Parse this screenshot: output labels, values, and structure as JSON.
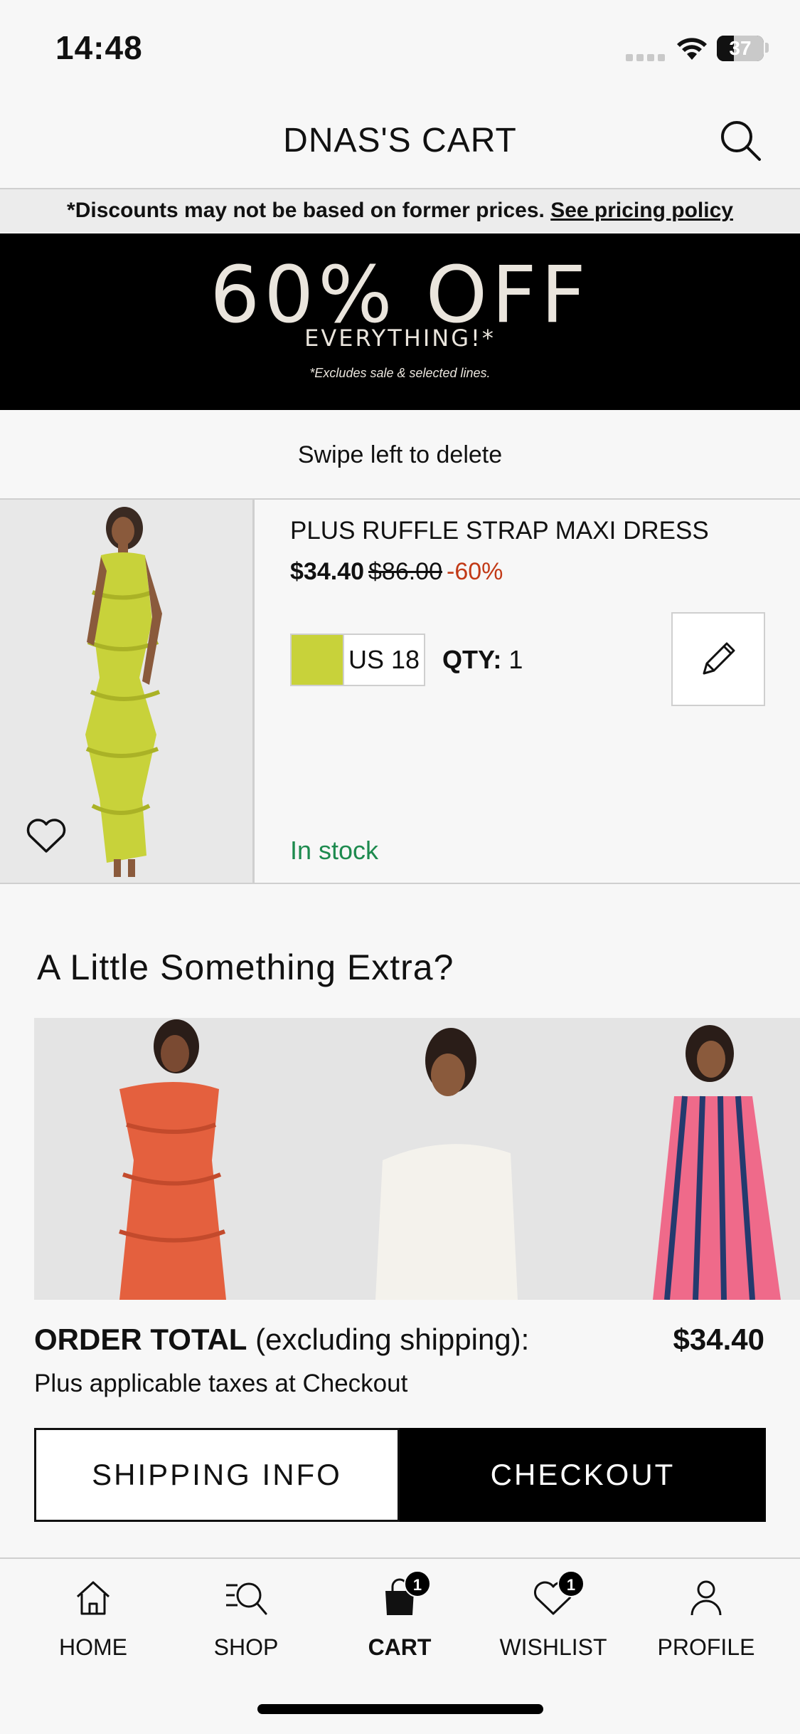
{
  "status_bar": {
    "time": "14:48",
    "battery": "37",
    "battery_level": 0.37
  },
  "header": {
    "title": "DNAS'S CART",
    "search_icon": "search-icon"
  },
  "disclaimer": {
    "text": "*Discounts may not be based on former prices. ",
    "link": "See pricing policy"
  },
  "promo": {
    "headline": "60% OFF",
    "subline": "EVERYTHING!*",
    "fineprint": "*Excludes sale & selected lines."
  },
  "swipe_hint": "Swipe left to delete",
  "cart_item": {
    "name": "PLUS RUFFLE STRAP MAXI DRESS",
    "price": "$34.40",
    "original_price": "$86.00",
    "discount": "-60%",
    "color_hex": "#c8d23a",
    "size": "US 18",
    "qty_label": "QTY:",
    "qty_value": "1",
    "stock": "In stock",
    "icons": [
      "heart-icon",
      "pencil-icon"
    ]
  },
  "extras": {
    "title": "A Little Something Extra?"
  },
  "order": {
    "label": "ORDER TOTAL",
    "note": " (excluding shipping):",
    "total": "$34.40",
    "taxes": "Plus applicable taxes at Checkout"
  },
  "buttons": {
    "shipping": "SHIPPING INFO",
    "checkout": "CHECKOUT"
  },
  "tabs": [
    {
      "label": "HOME",
      "icon": "home-icon"
    },
    {
      "label": "SHOP",
      "icon": "shop-search-icon"
    },
    {
      "label": "CART",
      "icon": "bag-icon",
      "badge": "1"
    },
    {
      "label": "WISHLIST",
      "icon": "heart-icon",
      "badge": "1"
    },
    {
      "label": "PROFILE",
      "icon": "person-icon"
    }
  ]
}
